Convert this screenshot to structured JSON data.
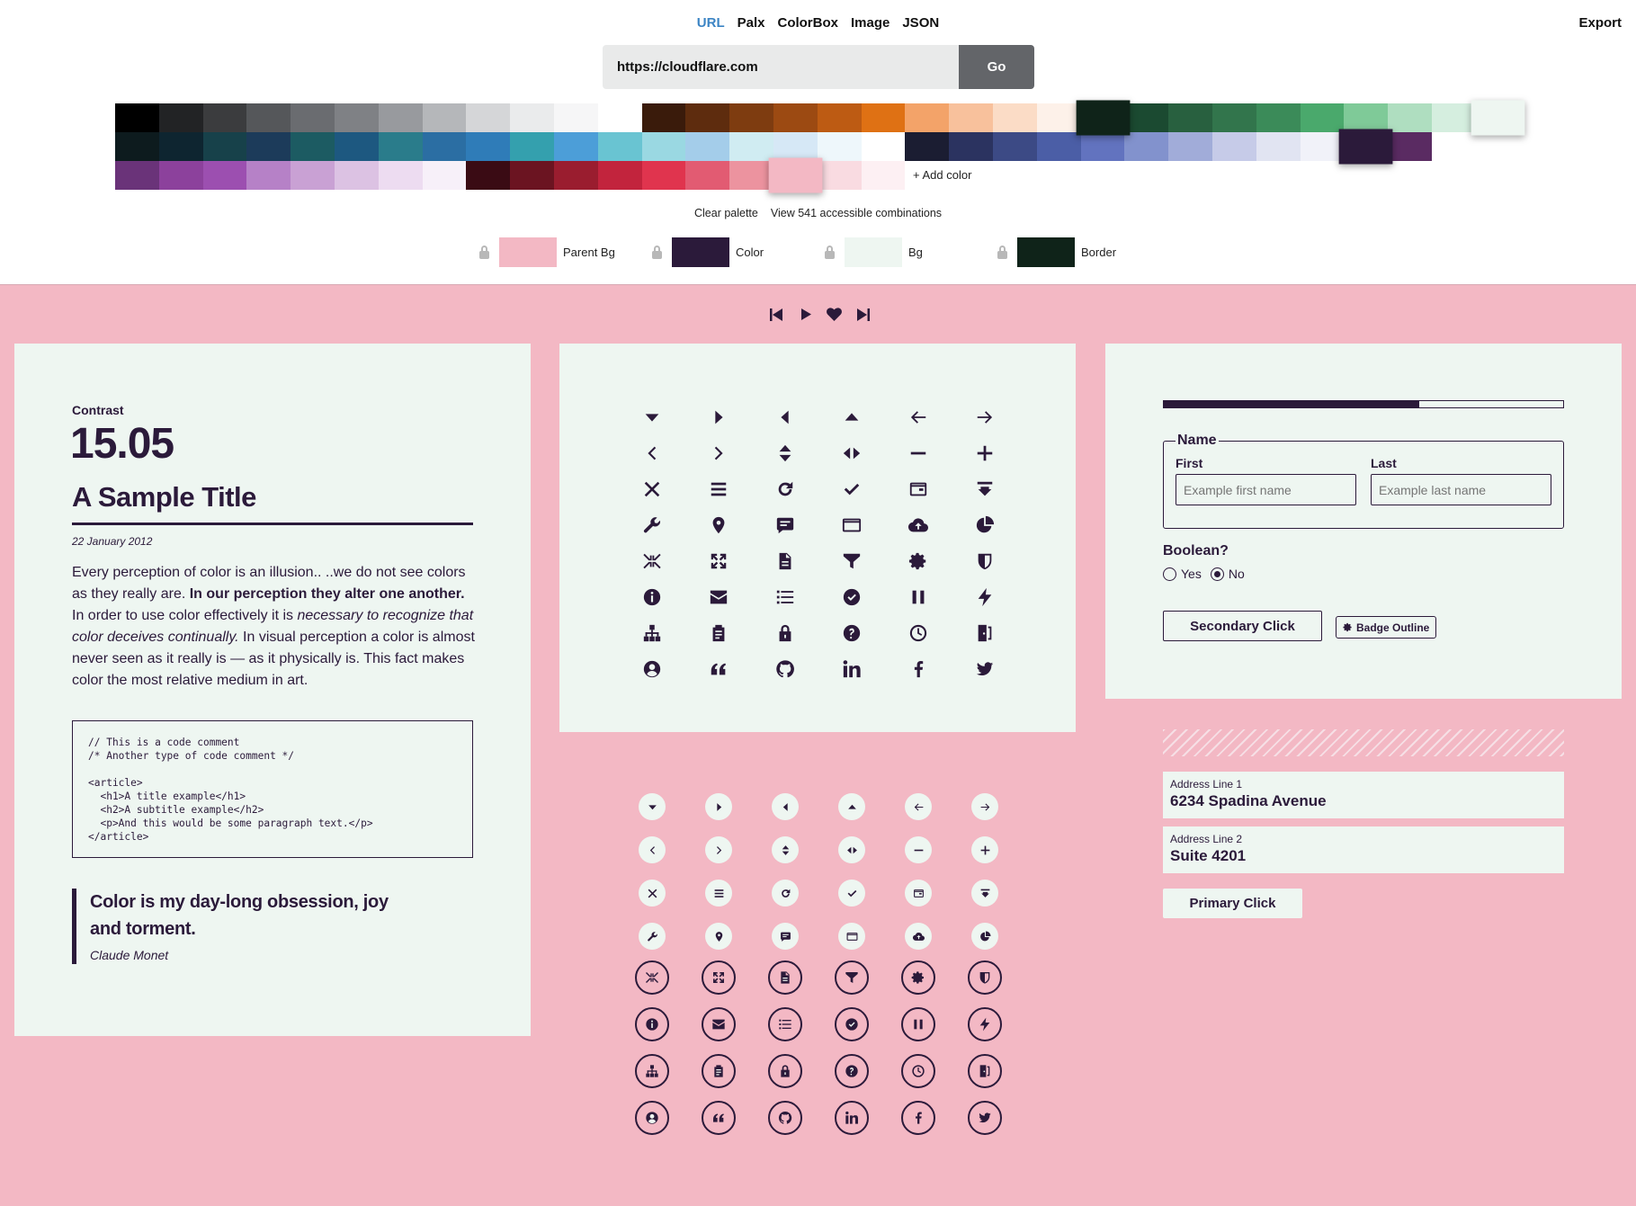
{
  "nav": {
    "tabs": [
      "URL",
      "Palx",
      "ColorBox",
      "Image",
      "JSON"
    ],
    "active": "URL",
    "export_label": "Export"
  },
  "url_bar": {
    "value": "https://cloudflare.com",
    "go_label": "Go"
  },
  "palette": {
    "rows": [
      [
        "#000000",
        "#222325",
        "#3b3c3e",
        "#55575a",
        "#6a6c70",
        "#7f8185",
        "#989a9e",
        "#b5b7ba",
        "#d5d6d8",
        "#eaebec",
        "#f6f6f7",
        "#ffffff",
        "#3a1b0b",
        "#5e2c0e",
        "#7e3c10",
        "#9c4a12",
        "#bd5b13",
        "#df7114",
        "#f3a369",
        "#f8c19c",
        "#fbdcc6",
        "#fdf1e9",
        "#0f2319",
        "#1b4a31",
        "#28603f",
        "#32754c",
        "#3b8b59",
        "#4aa96c",
        "#7fca98",
        "#afdec0",
        "#d5eedf",
        "#eef6f1"
      ],
      [
        "#0d1b1e",
        "#0e2530",
        "#17414a",
        "#1c3b5a",
        "#1c5b62",
        "#1d5880",
        "#2a7c8b",
        "#2b6ea3",
        "#2f7cb8",
        "#34a0ae",
        "#4c9ed8",
        "#69c4d2",
        "#9ad8e2",
        "#a4cdea",
        "#d0ecf2",
        "#d6e8f6",
        "#eef7fb",
        "#ffffff",
        "#1b1d32",
        "#2b3360",
        "#3c4a85",
        "#4b5ea6",
        "#6273bf",
        "#8292cd",
        "#a1acd9",
        "#c6cbe8",
        "#e1e4f2",
        "#f1f2f9",
        "#2b1a3a",
        "#5a2b62"
      ],
      [
        "#6a3379",
        "#8c419c",
        "#9c4fb0",
        "#b681c7",
        "#c9a1d4",
        "#dcc2e3",
        "#eddcf1",
        "#f7f0f9",
        "#3a0b14",
        "#6b1421",
        "#9a1d2f",
        "#c2243d",
        "#e0344e",
        "#e25b72",
        "#ec939f",
        "#f3b8c4",
        "#f9dbe1",
        "#fdf0f3"
      ]
    ]
  },
  "add_color_label": "+ Add color",
  "links": {
    "clear": "Clear palette",
    "view": "View 541 accessible combinations"
  },
  "slots": [
    {
      "label": "Parent Bg",
      "color": "#f3b8c4"
    },
    {
      "label": "Color",
      "color": "#2b1a3a"
    },
    {
      "label": "Bg",
      "color": "#eef6f1"
    },
    {
      "label": "Border",
      "color": "#0f2319"
    }
  ],
  "sample": {
    "contrast_label": "Contrast",
    "contrast_value": "15.05",
    "title": "A Sample Title",
    "date": "22 January 2012",
    "para": {
      "p1": "Every perception of color is an illusion.. ..we do not see colors as they really are. ",
      "b1": "In our perception they alter one another.",
      "p2": " In order to use color effectively it is ",
      "e1": "necessary to recognize that color deceives continually.",
      "p3": " In visual perception a color is almost never seen as it really is — as it physically is. This fact makes color the most relative medium in art."
    },
    "code": "// This is a code comment\n/* Another type of code comment */\n\n<article>\n  <h1>A title example</h1>\n  <h2>A subtitle example</h2>\n  <p>And this would be some paragraph text.</p>\n</article>",
    "quote": "Color is my day-long obsession, joy and torment.",
    "author": "Claude Monet"
  },
  "icons": [
    "triangle-down-icon",
    "triangle-right-icon",
    "triangle-left-icon",
    "triangle-up-icon",
    "arrow-left-icon",
    "arrow-right-icon",
    "chevron-left-icon",
    "chevron-right-icon",
    "sort-vertical-icon",
    "sort-horizontal-icon",
    "minus-icon",
    "plus-icon",
    "close-icon",
    "menu-icon",
    "refresh-icon",
    "check-icon",
    "wallet-icon",
    "download-tray-icon",
    "wrench-icon",
    "location-pin-icon",
    "chat-icon",
    "credit-card-icon",
    "cloud-upload-icon",
    "pie-chart-icon",
    "collapse-icon",
    "expand-icon",
    "document-icon",
    "filter-icon",
    "gear-icon",
    "shield-icon",
    "info-icon",
    "mail-icon",
    "list-icon",
    "check-circle-icon",
    "pause-icon",
    "bolt-icon",
    "sitemap-icon",
    "clipboard-icon",
    "lock-icon",
    "question-icon",
    "clock-icon",
    "door-exit-icon",
    "user-circle-icon",
    "quote-icon",
    "github-icon",
    "linkedin-icon",
    "facebook-icon",
    "twitter-icon"
  ],
  "player_icons": [
    "skip-back-icon",
    "play-icon",
    "heart-icon",
    "skip-forward-icon"
  ],
  "form": {
    "progress": 0.64,
    "legend": "Name",
    "first_label": "First",
    "first_placeholder": "Example first name",
    "last_label": "Last",
    "last_placeholder": "Example last name",
    "bool_label": "Boolean?",
    "yes": "Yes",
    "no": "No",
    "selected": "No",
    "secondary_label": "Secondary Click",
    "badge_label": "Badge Outline"
  },
  "address": {
    "l1_label": "Address Line 1",
    "l1_value": "6234 Spadina Avenue",
    "l2_label": "Address Line 2",
    "l2_value": "Suite 4201",
    "primary_label": "Primary Click"
  }
}
